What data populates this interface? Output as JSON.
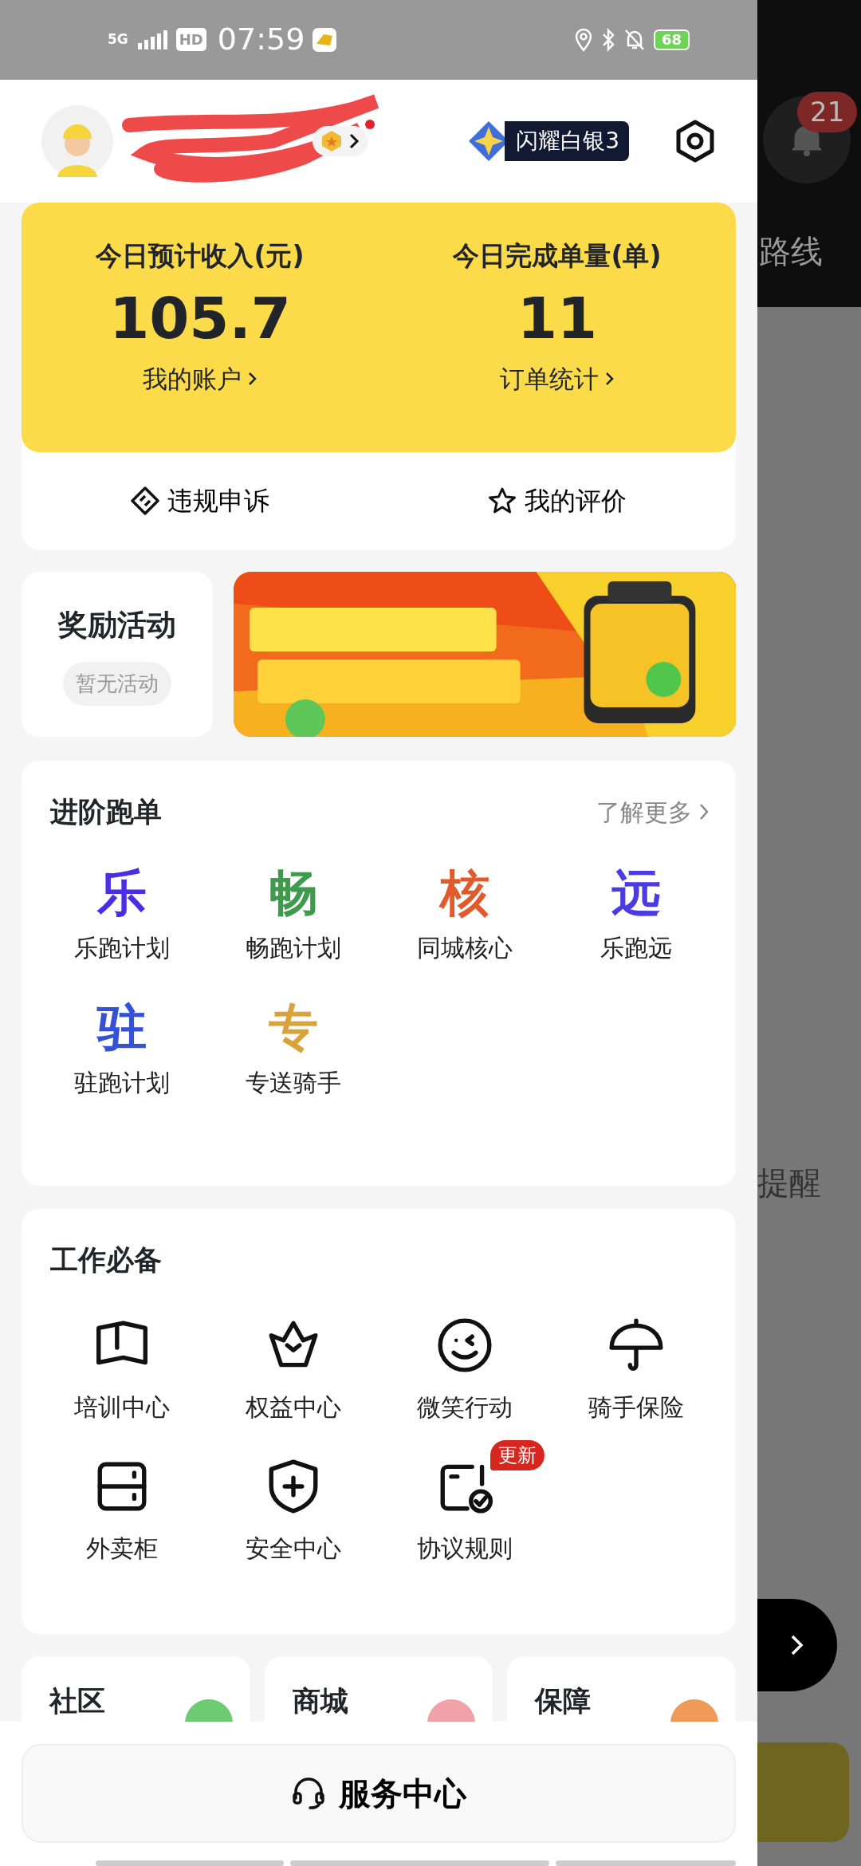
{
  "status_bar": {
    "network": "5G",
    "hd": "HD",
    "time": "07:59",
    "battery": "68"
  },
  "header": {
    "notification_dot": true,
    "rank": "闪耀白银3"
  },
  "summary": {
    "stats": [
      {
        "label": "今日预计收入(元)",
        "value": "105.7",
        "link": "我的账户"
      },
      {
        "label": "今日完成单量(单)",
        "value": "11",
        "link": "订单统计"
      }
    ],
    "actions": [
      "违规申诉",
      "我的评价"
    ]
  },
  "rewards": {
    "title": "奖励活动",
    "status": "暂无活动"
  },
  "advanced": {
    "title": "进阶跑单",
    "more": "了解更多",
    "items": [
      {
        "glyph": "乐",
        "color": "#4a2ee6",
        "label": "乐跑计划"
      },
      {
        "glyph": "畅",
        "color": "#3f9a4e",
        "label": "畅跑计划"
      },
      {
        "glyph": "核",
        "color": "#e2592c",
        "label": "同城核心"
      },
      {
        "glyph": "远",
        "color": "#4b3be3",
        "label": "乐跑远"
      },
      {
        "glyph": "驻",
        "color": "#3552d6",
        "label": "驻跑计划"
      },
      {
        "glyph": "专",
        "color": "#d9a33a",
        "label": "专送骑手"
      }
    ]
  },
  "essentials": {
    "title": "工作必备",
    "items": [
      {
        "label": "培训中心"
      },
      {
        "label": "权益中心"
      },
      {
        "label": "微笑行动"
      },
      {
        "label": "骑手保险"
      },
      {
        "label": "外卖柜"
      },
      {
        "label": "安全中心"
      },
      {
        "label": "协议规则",
        "badge": "更新"
      }
    ]
  },
  "bottom_cards": [
    {
      "title": "社区"
    },
    {
      "title": "商城"
    },
    {
      "title": "保障"
    }
  ],
  "service_button": "服务中心",
  "background": {
    "badge": "21",
    "texts": [
      "路线",
      "提醒"
    ]
  }
}
